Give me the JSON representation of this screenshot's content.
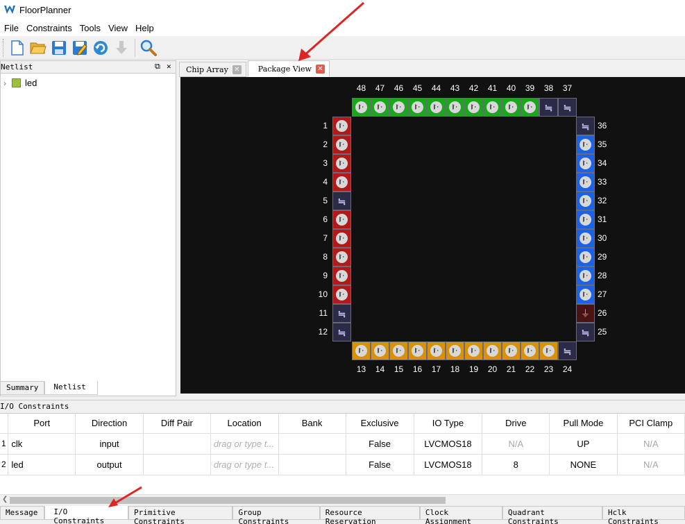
{
  "window": {
    "title": "FloorPlanner"
  },
  "menu": [
    "File",
    "Constraints",
    "Tools",
    "View",
    "Help"
  ],
  "toolbar": {
    "icons": [
      "new-file-icon",
      "open-folder-icon",
      "save-icon",
      "save-as-icon",
      "refresh-icon",
      "download-icon",
      "zoom-icon"
    ]
  },
  "netlist": {
    "header": "Netlist",
    "items": [
      {
        "label": "led"
      }
    ],
    "tabs": [
      "Summary",
      "Netlist"
    ]
  },
  "view_tabs": [
    {
      "label": "Chip Array",
      "active": false
    },
    {
      "label": "Package View",
      "active": true
    }
  ],
  "package": {
    "colors": {
      "left": "#b21a1a",
      "top": "#19a81c",
      "right": "#1a62e8",
      "bottom": "#d8920a",
      "power": "#2b2b48",
      "ground": "#4a1212"
    },
    "top": [
      {
        "n": "48",
        "t": "io"
      },
      {
        "n": "47",
        "t": "io"
      },
      {
        "n": "46",
        "t": "io"
      },
      {
        "n": "45",
        "t": "io"
      },
      {
        "n": "44",
        "t": "io"
      },
      {
        "n": "43",
        "t": "io"
      },
      {
        "n": "42",
        "t": "io"
      },
      {
        "n": "41",
        "t": "io"
      },
      {
        "n": "40",
        "t": "io"
      },
      {
        "n": "39",
        "t": "io"
      },
      {
        "n": "38",
        "t": "pwr"
      },
      {
        "n": "37",
        "t": "pwr"
      }
    ],
    "left": [
      {
        "n": "1",
        "t": "io"
      },
      {
        "n": "2",
        "t": "io"
      },
      {
        "n": "3",
        "t": "io"
      },
      {
        "n": "4",
        "t": "io"
      },
      {
        "n": "5",
        "t": "pwr"
      },
      {
        "n": "6",
        "t": "io"
      },
      {
        "n": "7",
        "t": "io"
      },
      {
        "n": "8",
        "t": "io"
      },
      {
        "n": "9",
        "t": "io"
      },
      {
        "n": "10",
        "t": "io"
      },
      {
        "n": "11",
        "t": "pwr"
      },
      {
        "n": "12",
        "t": "pwr"
      }
    ],
    "right": [
      {
        "n": "36",
        "t": "pwr"
      },
      {
        "n": "35",
        "t": "io"
      },
      {
        "n": "34",
        "t": "io"
      },
      {
        "n": "33",
        "t": "io"
      },
      {
        "n": "32",
        "t": "io"
      },
      {
        "n": "31",
        "t": "io"
      },
      {
        "n": "30",
        "t": "io"
      },
      {
        "n": "29",
        "t": "io"
      },
      {
        "n": "28",
        "t": "io"
      },
      {
        "n": "27",
        "t": "io"
      },
      {
        "n": "26",
        "t": "gnd"
      },
      {
        "n": "25",
        "t": "pwr"
      }
    ],
    "bottom": [
      {
        "n": "13",
        "t": "io"
      },
      {
        "n": "14",
        "t": "io"
      },
      {
        "n": "15",
        "t": "io"
      },
      {
        "n": "16",
        "t": "io"
      },
      {
        "n": "17",
        "t": "io"
      },
      {
        "n": "18",
        "t": "io"
      },
      {
        "n": "19",
        "t": "io"
      },
      {
        "n": "20",
        "t": "io"
      },
      {
        "n": "21",
        "t": "io"
      },
      {
        "n": "22",
        "t": "io"
      },
      {
        "n": "23",
        "t": "io"
      },
      {
        "n": "24",
        "t": "pwr"
      }
    ]
  },
  "io_constraints": {
    "header": "I/O Constraints",
    "columns": [
      "Port",
      "Direction",
      "Diff Pair",
      "Location",
      "Bank",
      "Exclusive",
      "IO Type",
      "Drive",
      "Pull Mode",
      "PCI Clamp"
    ],
    "rows": [
      [
        "1",
        "clk",
        "input",
        "",
        "drag or type t...",
        "",
        "False",
        "LVCMOS18",
        "N/A",
        "UP",
        "N/A"
      ],
      [
        "2",
        "led",
        "output",
        "",
        "drag or type t...",
        "",
        "False",
        "LVCMOS18",
        "8",
        "NONE",
        "N/A"
      ]
    ]
  },
  "bottom_tabs": [
    {
      "label": "Message",
      "active": false
    },
    {
      "label": "I/O Constraints",
      "active": true
    },
    {
      "label": "Primitive Constraints",
      "active": false
    },
    {
      "label": "Group Constraints",
      "active": false
    },
    {
      "label": "Resource Reservation",
      "active": false
    },
    {
      "label": "Clock Assignment",
      "active": false
    },
    {
      "label": "Quadrant Constraints",
      "active": false
    },
    {
      "label": "Hclk Constraints",
      "active": false
    }
  ]
}
